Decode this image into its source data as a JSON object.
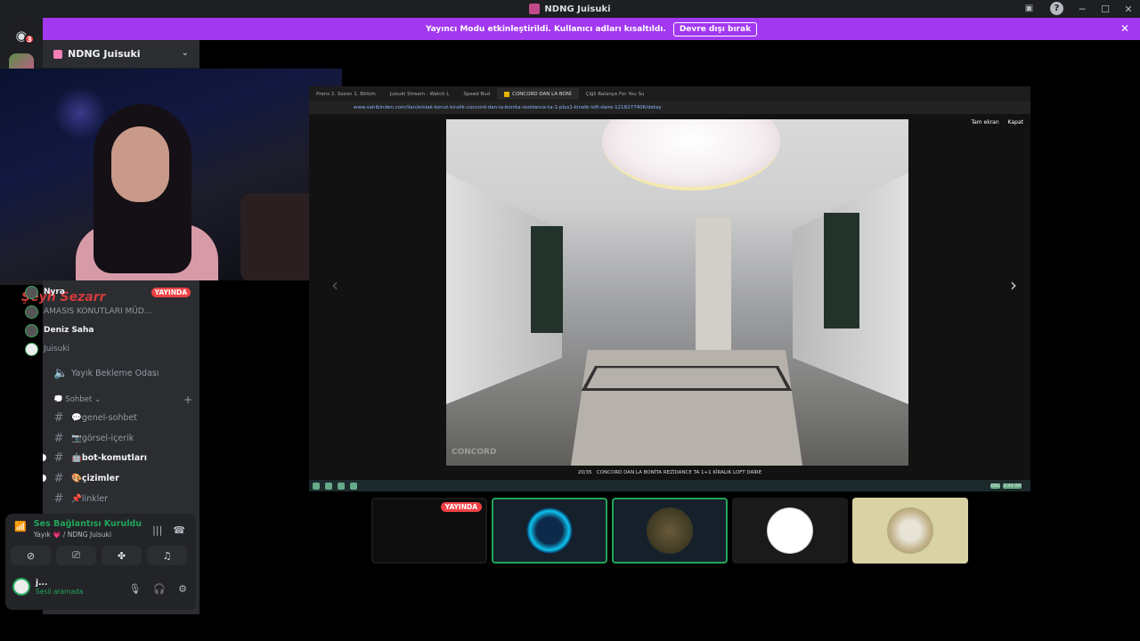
{
  "window": {
    "title": "NDNG Juisuki"
  },
  "banner": {
    "message": "Yayıncı Modu etkinleştirildi. Kullanıcı adları kısaltıldı.",
    "button": "Devre dışı bırak"
  },
  "rail": {
    "badge": "3"
  },
  "server": {
    "name": "NDNG Juisuki"
  },
  "voice_users": [
    {
      "name": "Nyra",
      "live": "YAYINDA"
    },
    {
      "name": "AMASIS KONUTLARI MÜD..."
    },
    {
      "name": "Deniz Saha"
    },
    {
      "name": "Juisuki"
    }
  ],
  "logo_text": "Şeyh Sezarr",
  "channels": {
    "waiting_room": "Yayık Bekleme Odası",
    "category": "Sohbet",
    "items": [
      {
        "name": "genel-sohbet",
        "emoji": "💬"
      },
      {
        "name": "görsel-içerik",
        "emoji": "📷"
      },
      {
        "name": "bot-komutları",
        "emoji": "🤖"
      },
      {
        "name": "çizimler",
        "emoji": "🎨"
      },
      {
        "name": "linkler",
        "emoji": "📌"
      }
    ]
  },
  "voice_panel": {
    "status": "Ses Bağlantısı Kuruldu",
    "location": "Yayık 💗 / NDNG Juisuki",
    "user_name": "j...",
    "user_status": "Sesli aramada"
  },
  "stream": {
    "tabs": [
      "Prens 2. Sezon 1. Bölüm",
      "juisuki Stream - Watch L",
      "Speed Bud",
      "CONCORD DAN LA BONİ",
      "Çiğli Balançe For You Su"
    ],
    "url": "www.sahibinden.com/ilan/emlak-konut-kiralik-concord-dan-la-bonita-rezidance-ta-1-plus1-kiralik-loft-daire-1218277406/detay",
    "fullscreen": "Tam ekran",
    "close": "Kapat",
    "counter": "20/35",
    "caption": "CONCORD DAN LA BONİTA REZİDANCE TA 1+1 KİRALIK LOFT DAİRE",
    "watermark": "CONCORD",
    "lang": "ENG",
    "time": "3:49 AM"
  },
  "tiles": [
    {
      "live": "YAYINDA"
    }
  ]
}
